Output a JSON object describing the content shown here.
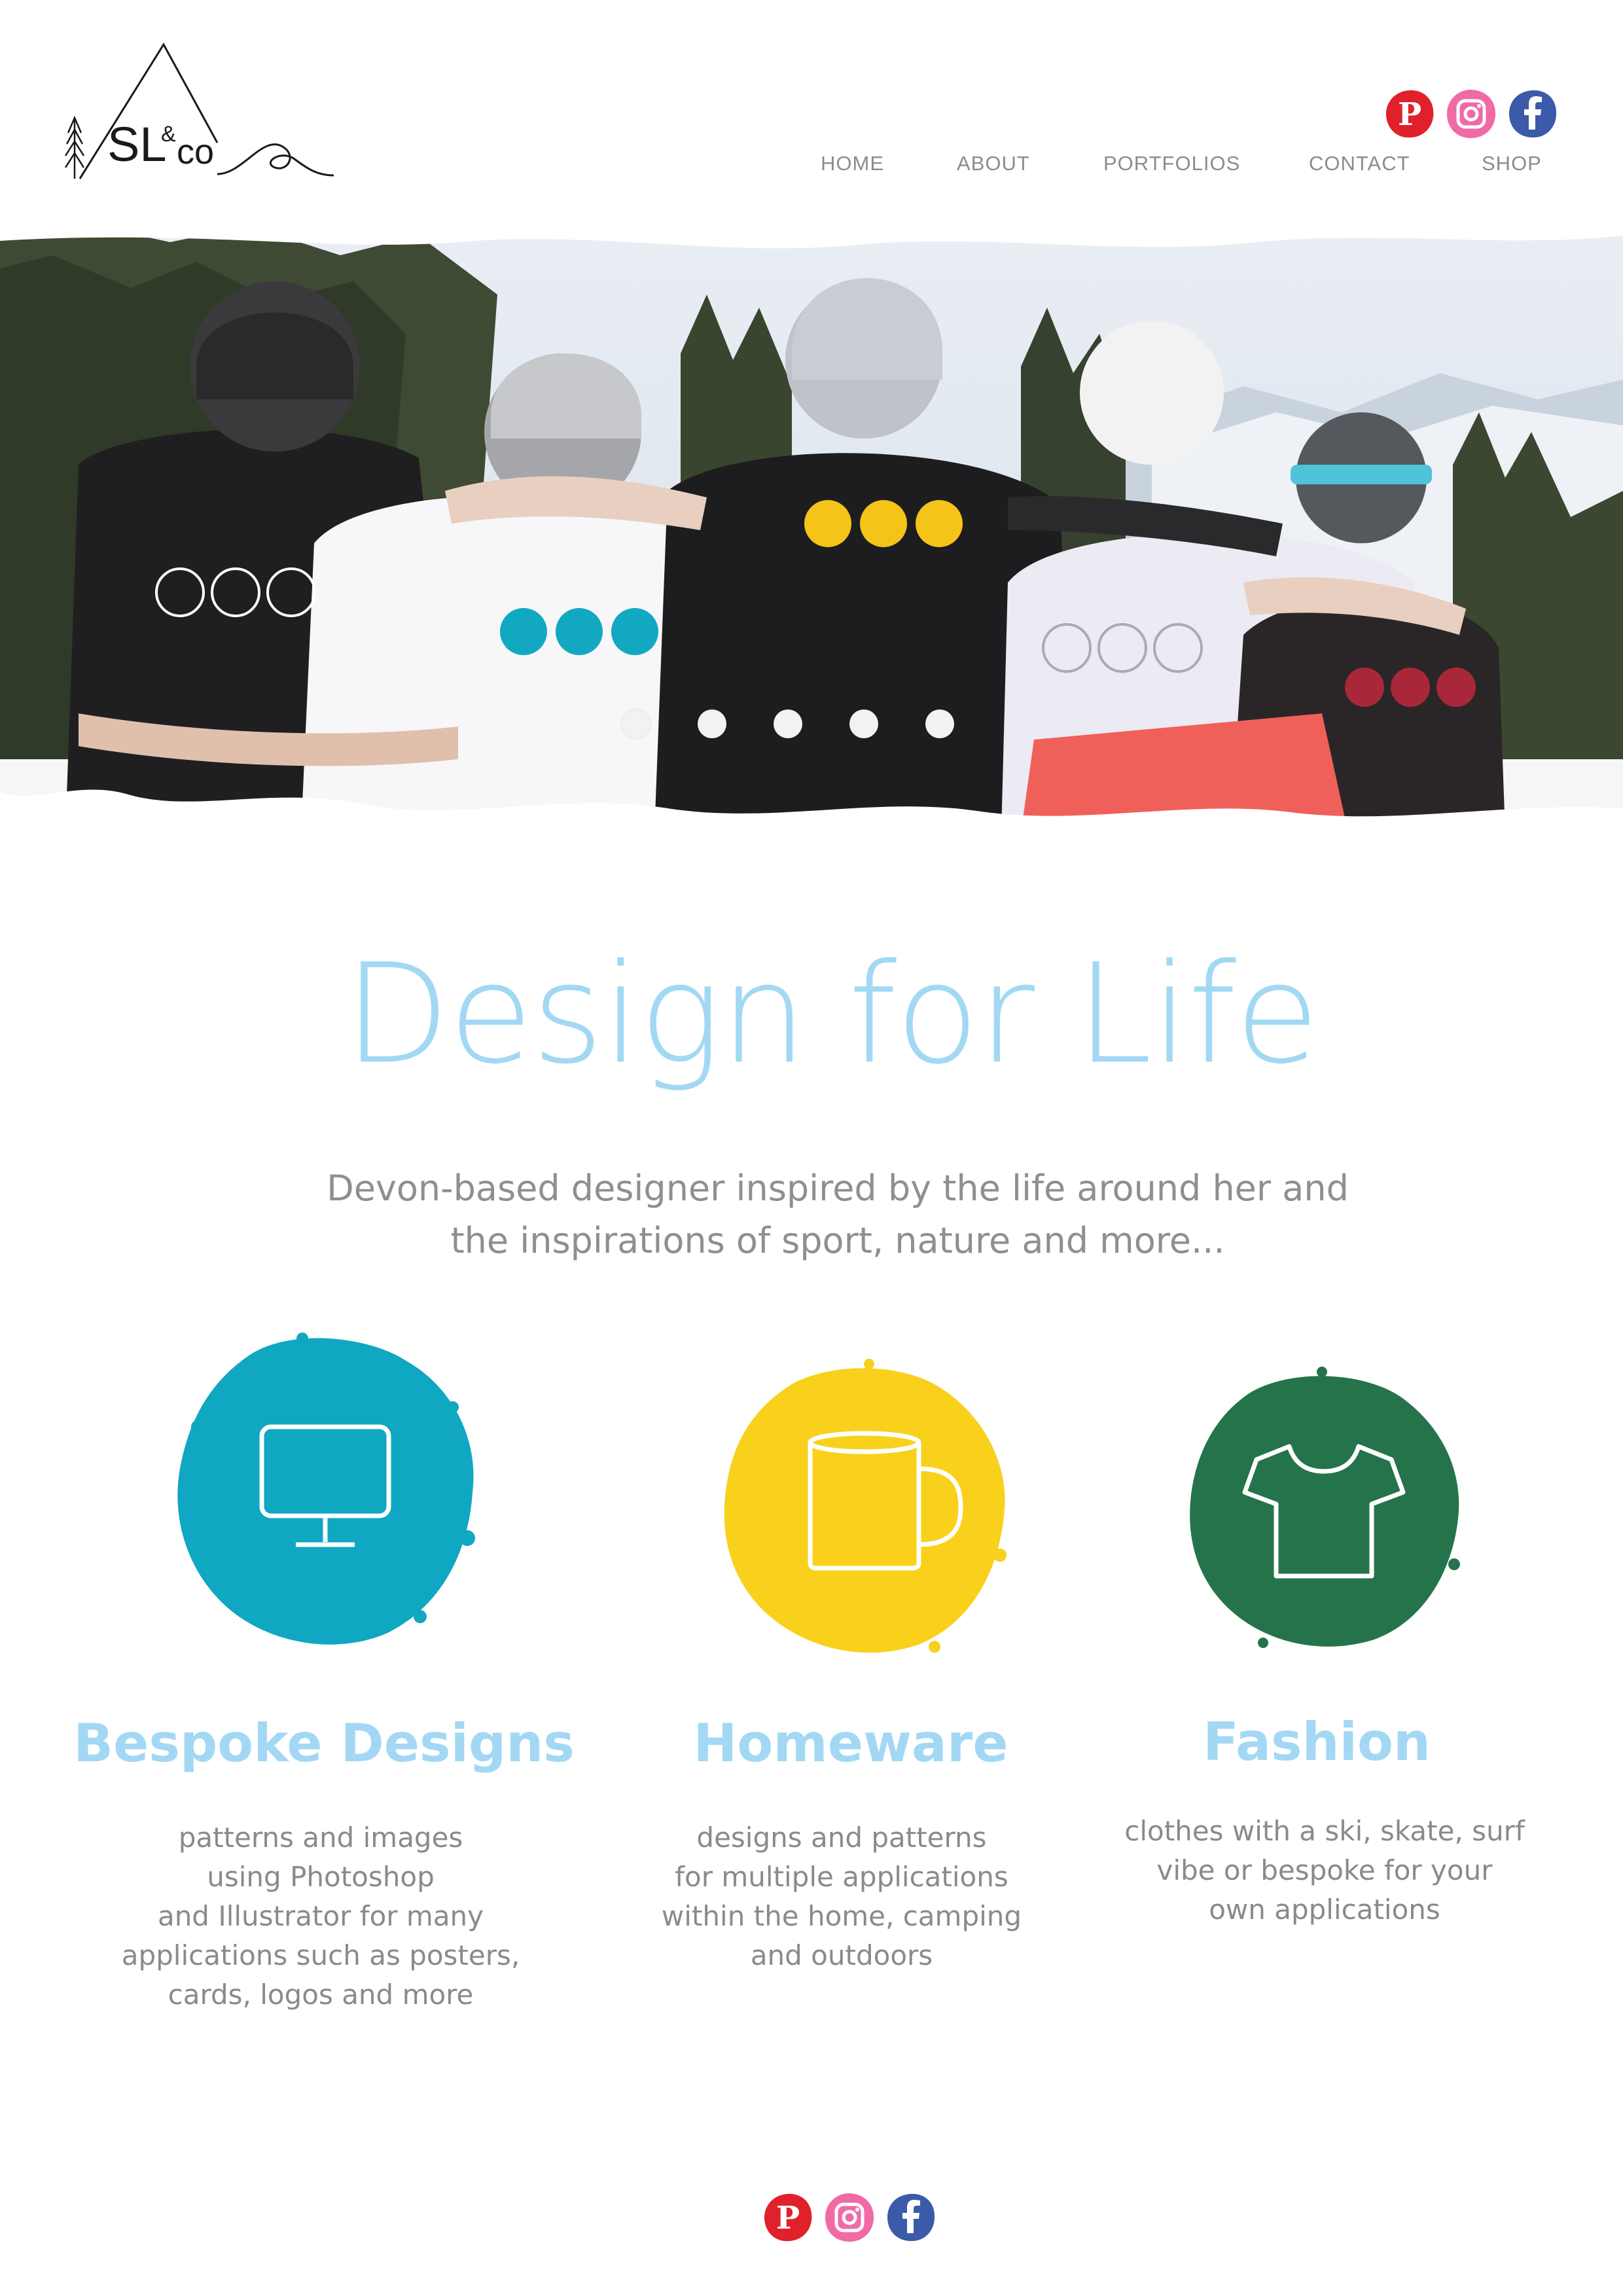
{
  "logo": {
    "main": "SL",
    "amp": "&",
    "co": "co"
  },
  "nav": {
    "items": [
      "HOME",
      "ABOUT",
      "PORTFOLIOS",
      "CONTACT",
      "SHOP"
    ]
  },
  "social": [
    {
      "name": "pinterest-icon",
      "color": "#e0202a"
    },
    {
      "name": "instagram-icon",
      "color": "#f06aa6"
    },
    {
      "name": "facebook-icon",
      "color": "#3b5aa8"
    }
  ],
  "hero": {
    "dots": 5,
    "shirt_logos_colors": [
      "#ffffff",
      "#13a8c2",
      "#f4c418",
      "#c7c7d6",
      "#a8283a"
    ]
  },
  "intro": {
    "headline": "Design for Life",
    "tagline_line1": "Devon-based designer inspired by the life around her and",
    "tagline_line2": "the inspirations of sport, nature and more..."
  },
  "services": [
    {
      "title": "Bespoke Designs",
      "icon": "monitor-icon",
      "color": "#0fa7c2",
      "lines": [
        "patterns and images",
        "using Photoshop",
        "and Illustrator for many",
        "applications such as posters,",
        "cards, logos and more"
      ]
    },
    {
      "title": "Homeware",
      "icon": "mug-icon",
      "color": "#f9d11c",
      "lines": [
        "designs and patterns",
        "for multiple applications",
        "within the home, camping",
        "and outdoors"
      ]
    },
    {
      "title": "Fashion",
      "icon": "tshirt-icon",
      "color": "#25734a",
      "lines": [
        "clothes with a ski, skate, surf",
        "vibe or bespoke for your",
        "own applications"
      ]
    }
  ]
}
